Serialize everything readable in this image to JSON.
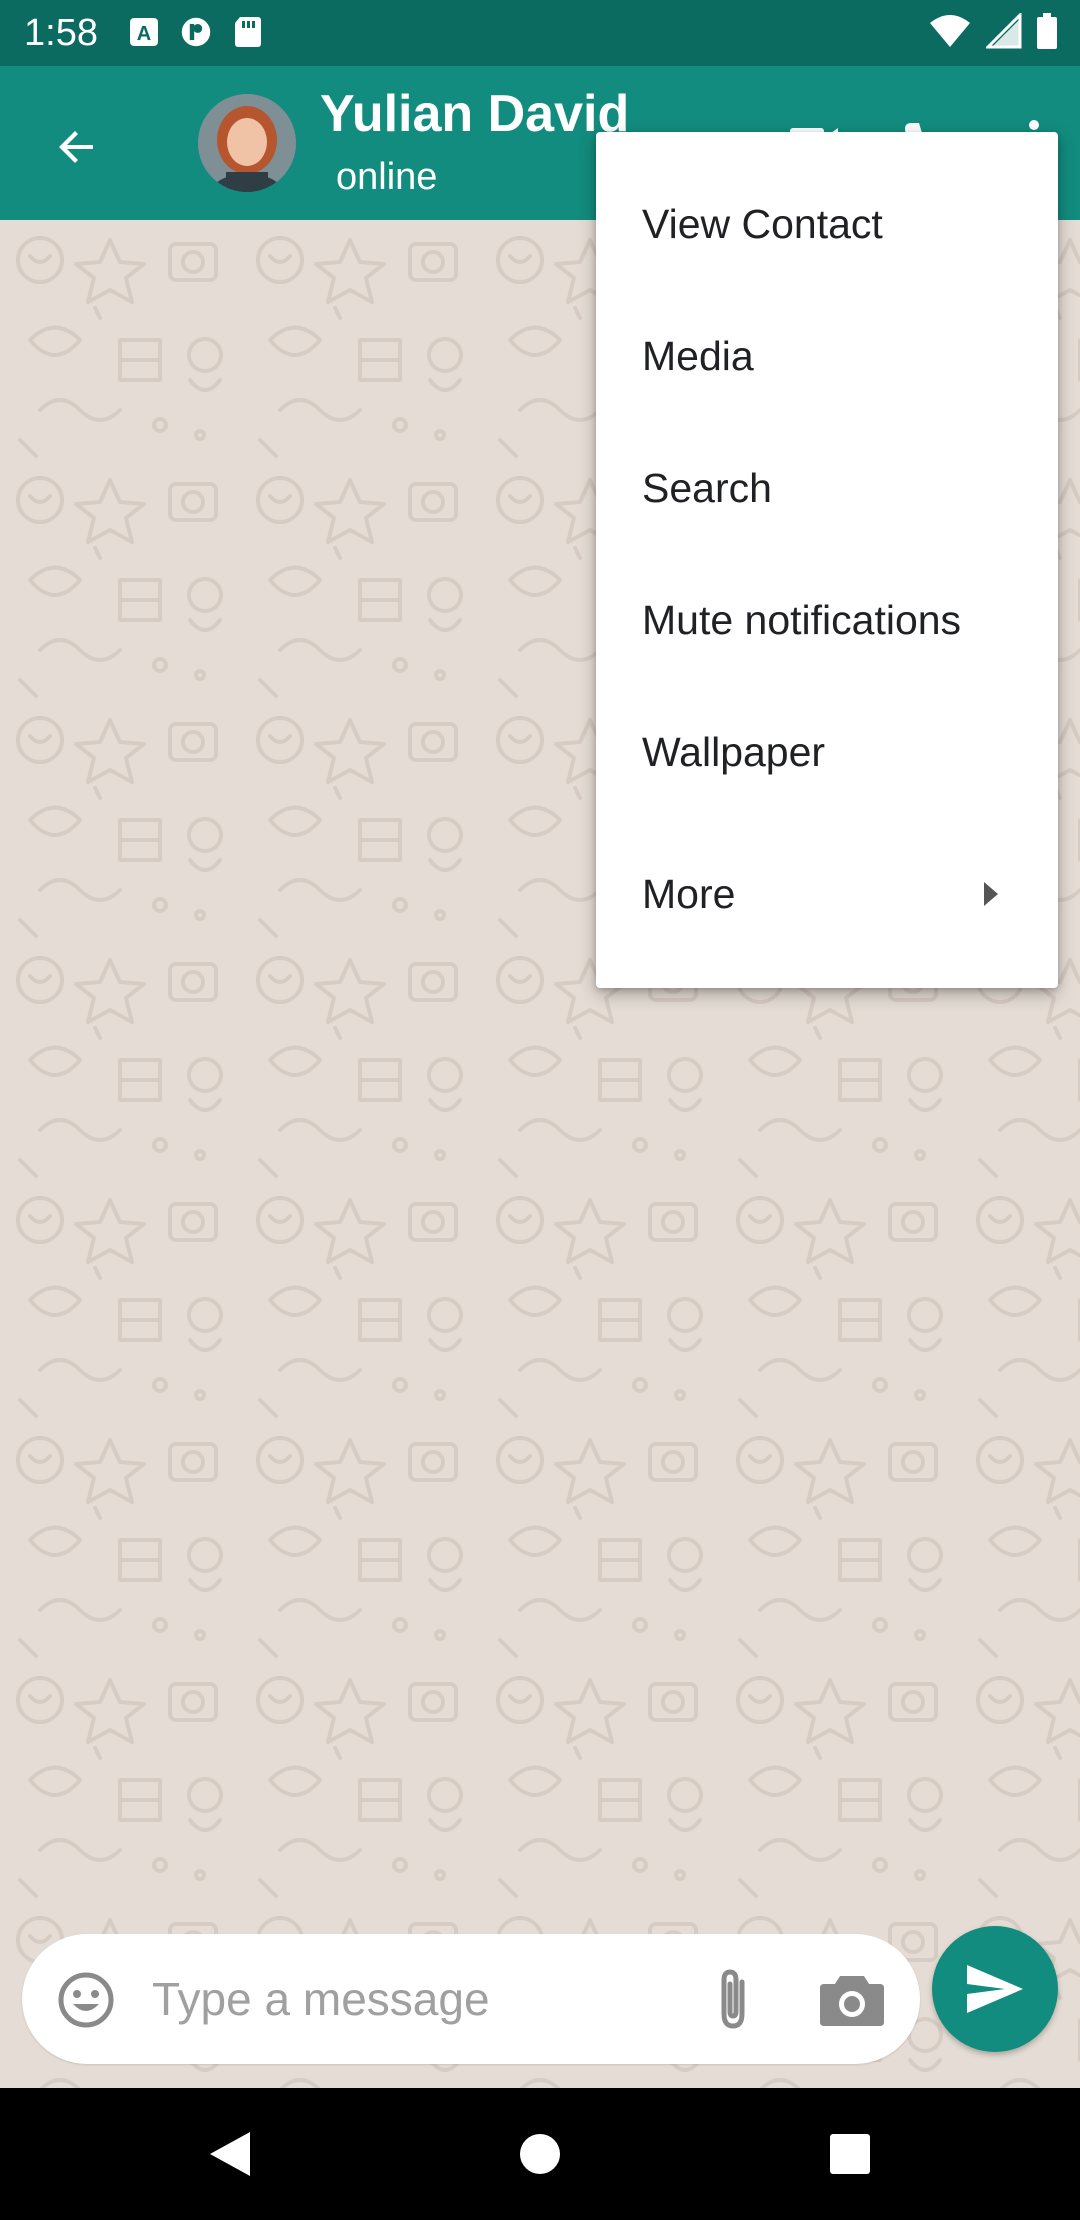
{
  "status_bar": {
    "time": "1:58",
    "left_icons": [
      "a-badge-icon",
      "p-badge-icon",
      "sd-card-icon"
    ],
    "right_icons": [
      "wifi-icon",
      "signal-icon",
      "battery-icon"
    ]
  },
  "header": {
    "contact_name": "Yulian David",
    "contact_status": "online",
    "avatar": "contact-avatar",
    "actions": [
      "video-call-icon",
      "voice-call-icon",
      "overflow-menu-icon"
    ]
  },
  "menu": {
    "items": [
      {
        "label": "View Contact"
      },
      {
        "label": "Media"
      },
      {
        "label": "Search"
      },
      {
        "label": "Mute notifications"
      },
      {
        "label": "Wallpaper"
      },
      {
        "label": "More",
        "has_submenu": true
      }
    ]
  },
  "composer": {
    "placeholder": "Type a message",
    "icons": [
      "emoji-icon",
      "paperclip-icon",
      "camera-icon",
      "send-icon"
    ]
  },
  "nav_bar": {
    "buttons": [
      "back-triangle-icon",
      "home-circle-icon",
      "recents-square-icon"
    ]
  },
  "colors": {
    "status_bar": "#0b6b61",
    "app_bar": "#128c7e",
    "chat_bg": "#e5ddd5",
    "send_button": "#128c7e"
  }
}
